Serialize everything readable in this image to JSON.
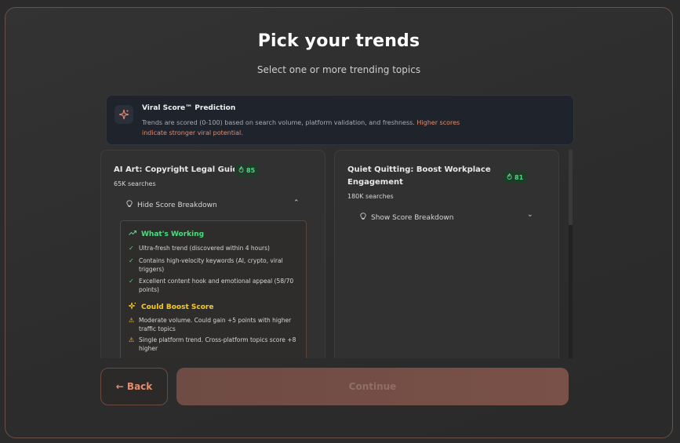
{
  "header": {
    "title": "Pick your trends",
    "subtitle": "Select one or more trending topics"
  },
  "info": {
    "icon": "sparkle-icon",
    "title": "Viral Score™ Prediction",
    "text": "Trends are scored (0-100) based on search volume, platform validation, and freshness.",
    "highlight": "Higher scores indicate stronger viral potential."
  },
  "cards": [
    {
      "title": "AI Art: Copyright Legal Guide",
      "score": "85",
      "searches": "65K searches",
      "toggle_label": "Hide Score Breakdown",
      "breakdown": {
        "working_title": "What's Working",
        "working_items": [
          "Ultra-fresh trend (discovered within 4 hours)",
          "Contains high-velocity keywords (AI, crypto, viral triggers)",
          "Excellent content hook and emotional appeal (58/70 points)"
        ],
        "boost_title": "Could Boost Score",
        "boost_items": [
          "Moderate volume. Could gain +5 points with higher traffic topics",
          "Single platform trend. Cross-platform topics score +8 higher"
        ]
      }
    },
    {
      "title": "Quiet Quitting: Boost Workplace Engagement",
      "score": "81",
      "searches": "180K searches",
      "toggle_label": "Show Score Breakdown"
    }
  ],
  "footer": {
    "back_label": "← Back",
    "continue_label": "Continue"
  },
  "colors": {
    "accent": "#e88b6c",
    "score_green": "#4ade80",
    "boost_yellow": "#facc15"
  }
}
